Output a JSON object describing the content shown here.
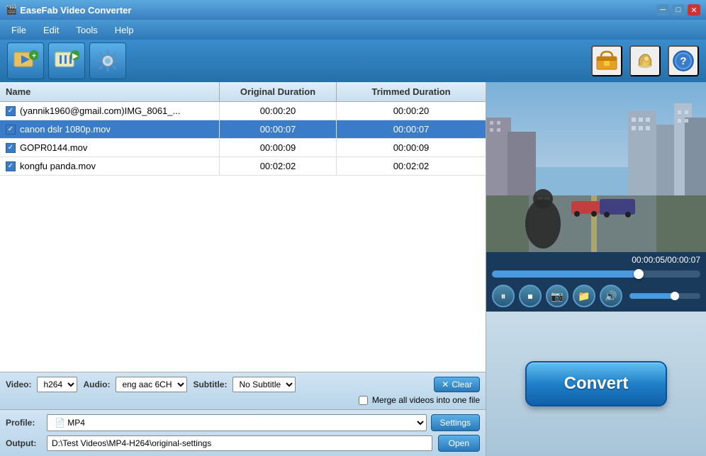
{
  "app": {
    "title": "EaseFab Video Converter",
    "icon": "🎬"
  },
  "titlebar": {
    "minimize_label": "─",
    "maximize_label": "□",
    "close_label": "✕"
  },
  "menu": {
    "items": [
      "File",
      "Edit",
      "Tools",
      "Help"
    ]
  },
  "toolbar": {
    "add_video_label": "➕🎬",
    "edit_video_label": "✂️🎬",
    "settings_label": "⚙️",
    "cart_label": "🛒",
    "key_label": "🔑",
    "help_label": "🔵"
  },
  "file_list": {
    "columns": [
      "Name",
      "Original Duration",
      "Trimmed Duration"
    ],
    "rows": [
      {
        "checked": true,
        "name": "(yannik1960@gmail.com)IMG_8061_...",
        "original": "00:00:20",
        "trimmed": "00:00:20",
        "selected": false
      },
      {
        "checked": true,
        "name": "canon dslr 1080p.mov",
        "original": "00:00:07",
        "trimmed": "00:00:07",
        "selected": true
      },
      {
        "checked": true,
        "name": "GOPR0144.mov",
        "original": "00:00:09",
        "trimmed": "00:00:09",
        "selected": false
      },
      {
        "checked": true,
        "name": "kongfu panda.mov",
        "original": "00:02:02",
        "trimmed": "00:02:02",
        "selected": false
      }
    ]
  },
  "controls": {
    "video_label": "Video:",
    "video_value": "h264",
    "audio_label": "Audio:",
    "audio_value": "eng aac 6CH",
    "subtitle_label": "Subtitle:",
    "subtitle_value": "No Subtitle",
    "clear_label": "Clear",
    "merge_label": "Merge all videos into one file"
  },
  "profile": {
    "label": "Profile:",
    "value": "MP4",
    "icon": "📄",
    "settings_label": "Settings"
  },
  "output": {
    "label": "Output:",
    "value": "D:\\Test Videos\\MP4-H264\\original-settings",
    "open_label": "Open"
  },
  "video_player": {
    "time_display": "00:00:05/00:00:07",
    "seek_percent": 70,
    "volume_percent": 60
  },
  "convert": {
    "label": "Convert"
  }
}
